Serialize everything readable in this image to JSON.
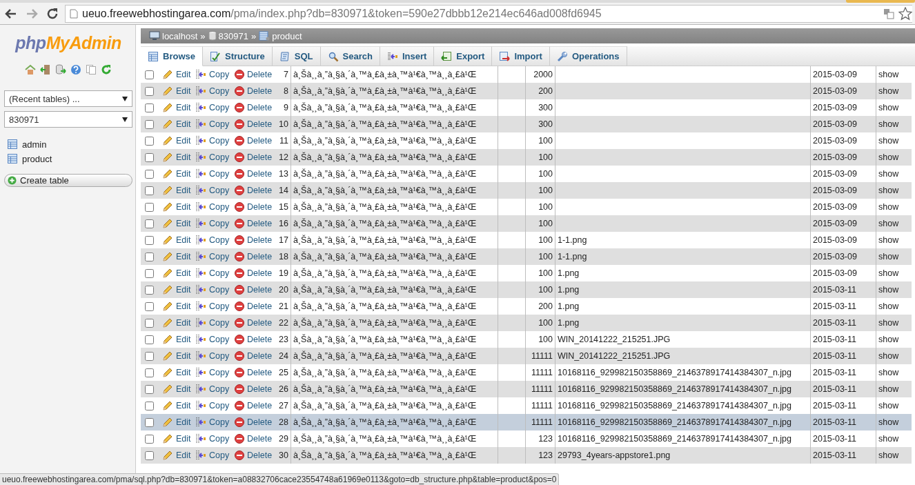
{
  "browser": {
    "url_host": "ueuo.freewebhostingarea.com",
    "url_path": "/pma/index.php?db=830971&token=590e27dbbb12e214ec646ad008fd6945",
    "status_url": "ueuo.freewebhostingarea.com/pma/sql.php?db=830971&token=a08832706cace23554748a61969e0113&goto=db_structure.php&table=product&pos=0"
  },
  "sidebar": {
    "logo_php": "php",
    "logo_myadmin": "MyAdmin",
    "recent_tables": "(Recent tables) ...",
    "database": "830971",
    "tables": [
      "admin",
      "product"
    ],
    "create_button": "Create table"
  },
  "breadcrumb": [
    {
      "kind": "server",
      "label": "localhost",
      "separator": "»"
    },
    {
      "kind": "database",
      "label": "830971",
      "separator": "»"
    },
    {
      "kind": "table",
      "label": "product"
    }
  ],
  "tabs": [
    {
      "kind": "browse",
      "label": "Browse",
      "selected": true
    },
    {
      "kind": "structure",
      "label": "Structure",
      "selected": false
    },
    {
      "kind": "sql",
      "label": "SQL",
      "selected": false
    },
    {
      "kind": "search",
      "label": "Search",
      "selected": false
    },
    {
      "kind": "insert",
      "label": "Insert",
      "selected": false
    },
    {
      "kind": "export",
      "label": "Export",
      "selected": false
    },
    {
      "kind": "import",
      "label": "Import",
      "selected": false
    },
    {
      "kind": "operations",
      "label": "Operations",
      "selected": false
    }
  ],
  "rows": [
    {
      "checked": false,
      "selected": false,
      "actions": [
        "Edit",
        "Copy",
        "Delete"
      ],
      "column_1": "7",
      "column_2": "à¸Šà¸¸à¸”à¸§à¸´à¸™à¸£à¸±à¸™à¹€à¸™à¸¸à¸£à¹Œ",
      "column_4": "2000",
      "column_6": "2015-03-09",
      "column_7": "show"
    },
    {
      "checked": false,
      "selected": false,
      "actions": [
        "Edit",
        "Copy",
        "Delete"
      ],
      "column_1": "8",
      "column_2": "à¸Šà¸¸à¸”à¸§à¸´à¸™à¸£à¸±à¸™à¹€à¸™à¸¸à¸£à¹Œ",
      "column_4": "200",
      "column_6": "2015-03-09",
      "column_7": "show"
    },
    {
      "checked": false,
      "selected": false,
      "actions": [
        "Edit",
        "Copy",
        "Delete"
      ],
      "column_1": "9",
      "column_2": "à¸Šà¸¸à¸”à¸§à¸´à¸™à¸£à¸±à¸™à¹€à¸™à¸¸à¸£à¹Œ",
      "column_4": "300",
      "column_6": "2015-03-09",
      "column_7": "show"
    },
    {
      "checked": false,
      "selected": false,
      "actions": [
        "Edit",
        "Copy",
        "Delete"
      ],
      "column_1": "10",
      "column_2": "à¸Šà¸¸à¸”à¸§à¸´à¸™à¸£à¸±à¸™à¹€à¸™à¸¸à¸£à¹Œ",
      "column_4": "300",
      "column_6": "2015-03-09",
      "column_7": "show"
    },
    {
      "checked": false,
      "selected": false,
      "actions": [
        "Edit",
        "Copy",
        "Delete"
      ],
      "column_1": "11",
      "column_2": "à¸Šà¸¸à¸”à¸§à¸´à¸™à¸£à¸±à¸™à¹€à¸™à¸¸à¸£à¹Œ",
      "column_4": "100",
      "column_6": "2015-03-09",
      "column_7": "show"
    },
    {
      "checked": false,
      "selected": false,
      "actions": [
        "Edit",
        "Copy",
        "Delete"
      ],
      "column_1": "12",
      "column_2": "à¸Šà¸¸à¸”à¸§à¸´à¸™à¸£à¸±à¸™à¹€à¸™à¸¸à¸£à¹Œ",
      "column_4": "100",
      "column_6": "2015-03-09",
      "column_7": "show"
    },
    {
      "checked": false,
      "selected": false,
      "actions": [
        "Edit",
        "Copy",
        "Delete"
      ],
      "column_1": "13",
      "column_2": "à¸Šà¸¸à¸”à¸§à¸´à¸™à¸£à¸±à¸™à¹€à¸™à¸¸à¸£à¹Œ",
      "column_4": "100",
      "column_6": "2015-03-09",
      "column_7": "show"
    },
    {
      "checked": false,
      "selected": false,
      "actions": [
        "Edit",
        "Copy",
        "Delete"
      ],
      "column_1": "14",
      "column_2": "à¸Šà¸¸à¸”à¸§à¸´à¸™à¸£à¸±à¸™à¹€à¸™à¸¸à¸£à¹Œ",
      "column_4": "100",
      "column_6": "2015-03-09",
      "column_7": "show"
    },
    {
      "checked": false,
      "selected": false,
      "actions": [
        "Edit",
        "Copy",
        "Delete"
      ],
      "column_1": "15",
      "column_2": "à¸Šà¸¸à¸”à¸§à¸´à¸™à¸£à¸±à¸™à¹€à¸™à¸¸à¸£à¹Œ",
      "column_4": "100",
      "column_6": "2015-03-09",
      "column_7": "show"
    },
    {
      "checked": false,
      "selected": false,
      "actions": [
        "Edit",
        "Copy",
        "Delete"
      ],
      "column_1": "16",
      "column_2": "à¸Šà¸¸à¸”à¸§à¸´à¸™à¸£à¸±à¸™à¹€à¸™à¸¸à¸£à¹Œ",
      "column_4": "100",
      "column_6": "2015-03-09",
      "column_7": "show"
    },
    {
      "checked": false,
      "selected": false,
      "actions": [
        "Edit",
        "Copy",
        "Delete"
      ],
      "column_1": "17",
      "column_2": "à¸Šà¸¸à¸”à¸§à¸´à¸™à¸£à¸±à¸™à¹€à¸™à¸¸à¸£à¹Œ",
      "column_4": "100",
      "column_5": "1-1.png",
      "column_6": "2015-03-09",
      "column_7": "show"
    },
    {
      "checked": false,
      "selected": false,
      "actions": [
        "Edit",
        "Copy",
        "Delete"
      ],
      "column_1": "18",
      "column_2": "à¸Šà¸¸à¸”à¸§à¸´à¸™à¸£à¸±à¸™à¹€à¸™à¸¸à¸£à¹Œ",
      "column_4": "100",
      "column_5": "1-1.png",
      "column_6": "2015-03-09",
      "column_7": "show"
    },
    {
      "checked": false,
      "selected": false,
      "actions": [
        "Edit",
        "Copy",
        "Delete"
      ],
      "column_1": "19",
      "column_2": "à¸Šà¸¸à¸”à¸§à¸´à¸™à¸£à¸±à¸™à¹€à¸™à¸¸à¸£à¹Œ",
      "column_4": "100",
      "column_5": "1.png",
      "column_6": "2015-03-09",
      "column_7": "show"
    },
    {
      "checked": false,
      "selected": false,
      "actions": [
        "Edit",
        "Copy",
        "Delete"
      ],
      "column_1": "20",
      "column_2": "à¸Šà¸¸à¸”à¸§à¸´à¸™à¸£à¸±à¸™à¹€à¸™à¸¸à¸£à¹Œ",
      "column_4": "100",
      "column_5": "1.png",
      "column_6": "2015-03-11",
      "column_7": "show"
    },
    {
      "checked": false,
      "selected": false,
      "actions": [
        "Edit",
        "Copy",
        "Delete"
      ],
      "column_1": "21",
      "column_2": "à¸Šà¸¸à¸”à¸§à¸´à¸™à¸£à¸±à¸™à¹€à¸™à¸¸à¸£à¹Œ",
      "column_4": "200",
      "column_5": "1.png",
      "column_6": "2015-03-11",
      "column_7": "show"
    },
    {
      "checked": false,
      "selected": false,
      "actions": [
        "Edit",
        "Copy",
        "Delete"
      ],
      "column_1": "22",
      "column_2": "à¸Šà¸¸à¸”à¸§à¸´à¸™à¸£à¸±à¸™à¹€à¸™à¸¸à¸£à¹Œ",
      "column_4": "100",
      "column_5": "1.png",
      "column_6": "2015-03-11",
      "column_7": "show"
    },
    {
      "checked": false,
      "selected": false,
      "actions": [
        "Edit",
        "Copy",
        "Delete"
      ],
      "column_1": "23",
      "column_2": "à¸Šà¸¸à¸”à¸§à¸´à¸™à¸£à¸±à¸™à¹€à¸™à¸¸à¸£à¹Œ",
      "column_4": "100",
      "column_5": "WIN_20141222_215251.JPG",
      "column_6": "2015-03-11",
      "column_7": "show"
    },
    {
      "checked": false,
      "selected": false,
      "actions": [
        "Edit",
        "Copy",
        "Delete"
      ],
      "column_1": "24",
      "column_2": "à¸Šà¸¸à¸”à¸§à¸´à¸™à¸£à¸±à¸™à¹€à¸™à¸¸à¸£à¹Œ",
      "column_4": "11111",
      "column_5": "WIN_20141222_215251.JPG",
      "column_6": "2015-03-11",
      "column_7": "show"
    },
    {
      "checked": false,
      "selected": false,
      "actions": [
        "Edit",
        "Copy",
        "Delete"
      ],
      "column_1": "25",
      "column_2": "à¸Šà¸¸à¸”à¸§à¸´à¸™à¸£à¸±à¸™à¹€à¸™à¸¸à¸£à¹Œ",
      "column_4": "11111",
      "column_5": "10168116_929982150358869_2146378917414384307_n.jpg",
      "column_6": "2015-03-11",
      "column_7": "show"
    },
    {
      "checked": false,
      "selected": false,
      "actions": [
        "Edit",
        "Copy",
        "Delete"
      ],
      "column_1": "26",
      "column_2": "à¸Šà¸¸à¸”à¸§à¸´à¸™à¸£à¸±à¸™à¹€à¸™à¸¸à¸£à¹Œ",
      "column_4": "11111",
      "column_5": "10168116_929982150358869_2146378917414384307_n.jpg",
      "column_6": "2015-03-11",
      "column_7": "show"
    },
    {
      "checked": false,
      "selected": false,
      "actions": [
        "Edit",
        "Copy",
        "Delete"
      ],
      "column_1": "27",
      "column_2": "à¸Šà¸¸à¸”à¸§à¸´à¸™à¸£à¸±à¸™à¹€à¸™à¸¸à¸£à¹Œ",
      "column_4": "11111",
      "column_5": "10168116_929982150358869_2146378917414384307_n.jpg",
      "column_6": "2015-03-11",
      "column_7": "show"
    },
    {
      "checked": false,
      "selected": true,
      "actions": [
        "Edit",
        "Copy",
        "Delete"
      ],
      "column_1": "28",
      "column_2": "à¸Šà¸¸à¸”à¸§à¸´à¸™à¸£à¸±à¸™à¹€à¸™à¸¸à¸£à¹Œ",
      "column_4": "11111",
      "column_5": "10168116_929982150358869_2146378917414384307_n.jpg",
      "column_6": "2015-03-11",
      "column_7": "show"
    },
    {
      "checked": false,
      "selected": false,
      "actions": [
        "Edit",
        "Copy",
        "Delete"
      ],
      "column_1": "29",
      "column_2": "à¸Šà¸¸à¸”à¸§à¸´à¸™à¸£à¸±à¸™à¹€à¸™à¸¸à¸£à¹Œ",
      "column_4": "123",
      "column_5": "10168116_929982150358869_2146378917414384307_n.jpg",
      "column_6": "2015-03-11",
      "column_7": "show"
    },
    {
      "checked": false,
      "selected": false,
      "actions": [
        "Edit",
        "Copy",
        "Delete"
      ],
      "column_1": "30",
      "column_2": "à¸Šà¸¸à¸”à¸§à¸´à¸™à¸£à¸±à¸™à¹€à¸™à¸¸à¸£à¹Œ",
      "column_4": "123",
      "column_5": "29793_4years-appstore1.png",
      "column_6": "2015-03-11",
      "column_7": "show"
    }
  ]
}
